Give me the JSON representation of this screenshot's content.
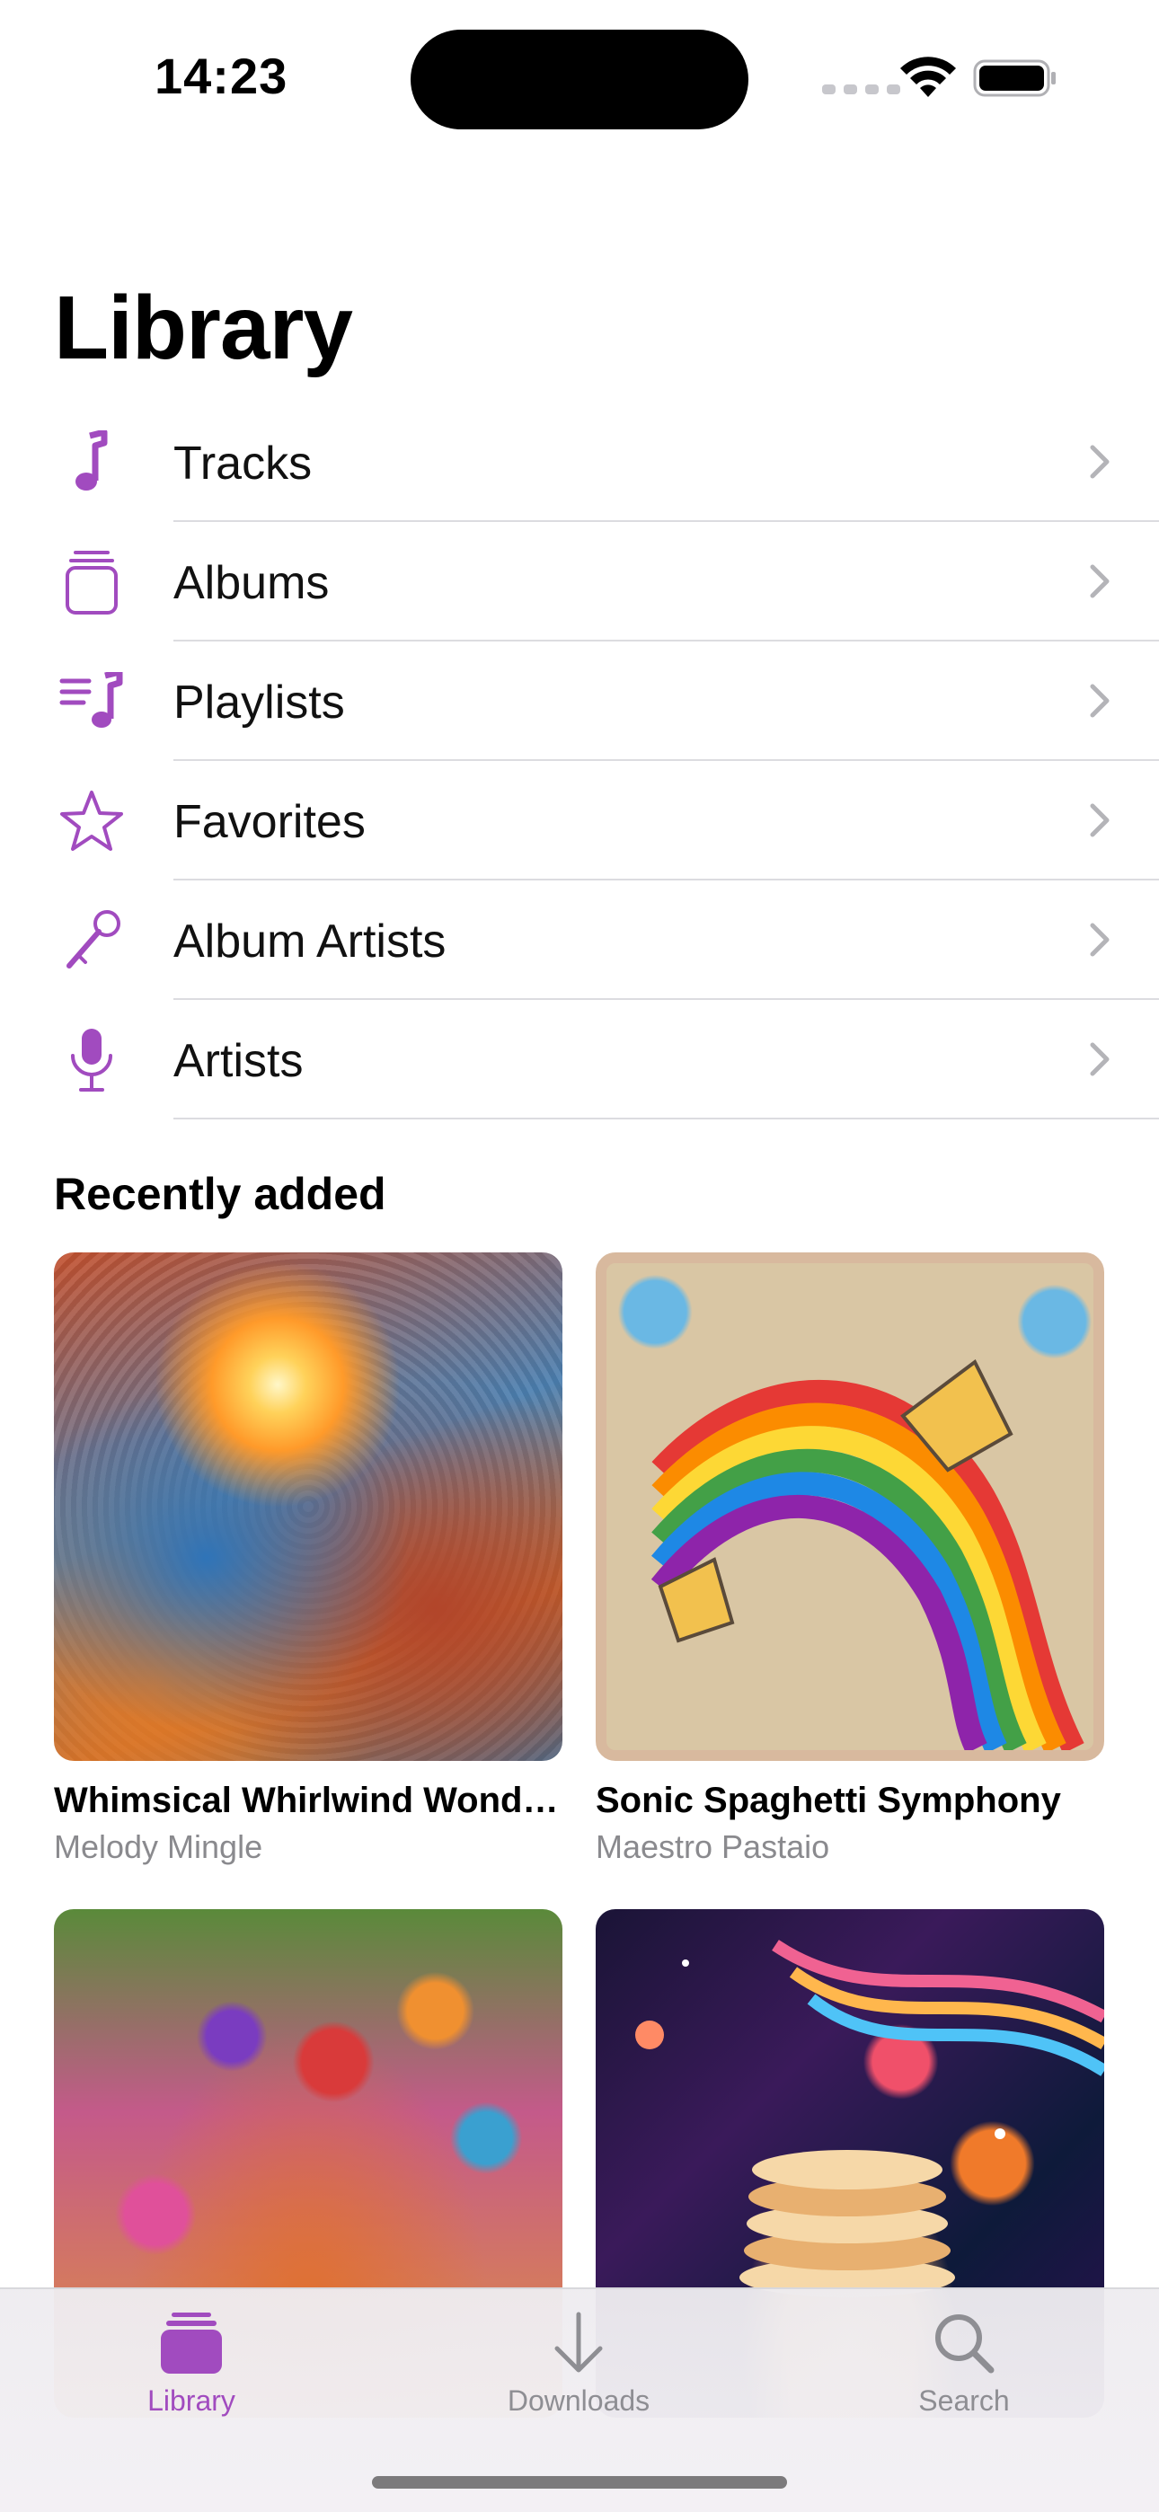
{
  "status_bar": {
    "time": "14:23"
  },
  "page_title": "Library",
  "menu": [
    {
      "label": "Tracks",
      "icon": "music-note-icon"
    },
    {
      "label": "Albums",
      "icon": "album-stack-icon"
    },
    {
      "label": "Playlists",
      "icon": "playlist-icon"
    },
    {
      "label": "Favorites",
      "icon": "star-icon"
    },
    {
      "label": "Album Artists",
      "icon": "microphone-stand-icon"
    },
    {
      "label": "Artists",
      "icon": "microphone-icon"
    }
  ],
  "recently_added": {
    "title": "Recently added",
    "albums": [
      {
        "title": "Whimsical Whirlwind Wonders",
        "artist": "Melody Mingle"
      },
      {
        "title": "Sonic Spaghetti Symphony",
        "artist": "Maestro Pastaio"
      },
      {
        "title": "",
        "artist": ""
      },
      {
        "title": "",
        "artist": ""
      }
    ]
  },
  "tab_bar": {
    "tabs": [
      {
        "label": "Library",
        "icon": "library-icon",
        "active": true
      },
      {
        "label": "Downloads",
        "icon": "download-icon",
        "active": false
      },
      {
        "label": "Search",
        "icon": "search-icon",
        "active": false
      }
    ]
  },
  "colors": {
    "accent": "#a14bbf",
    "secondary_text": "#8a8a8e",
    "divider": "#dcdce0"
  }
}
